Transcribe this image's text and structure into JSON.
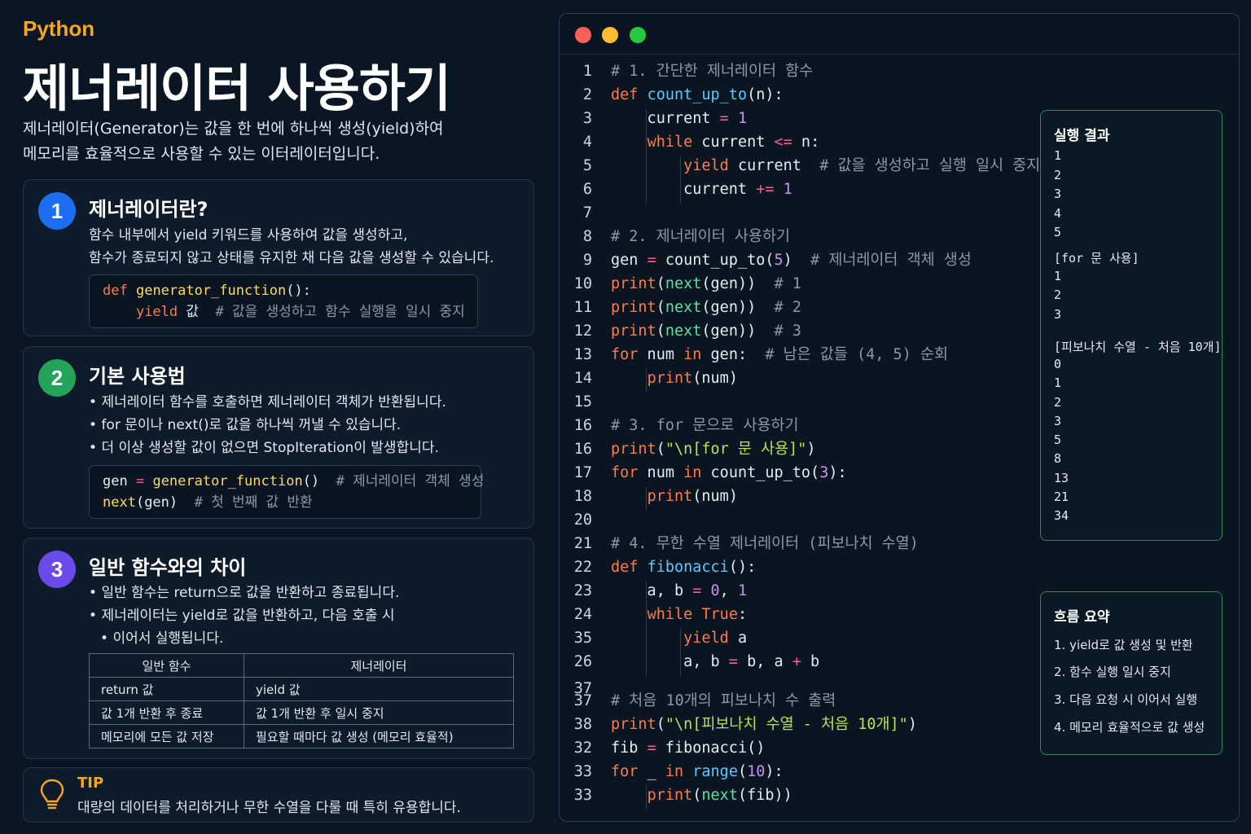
{
  "header": {
    "lang": "Python",
    "title": "제너레이터 사용하기",
    "intro_1": "제너레이터(Generator)는 값을 한 번에 하나씩 생성(yield)하여",
    "intro_2": "메모리를 효율적으로 사용할 수 있는 이터레이터입니다."
  },
  "cards": [
    {
      "num": "1",
      "title": "제너레이터란?",
      "text_1": "함수 내부에서 yield 키워드를 사용하여 값을 생성하고,",
      "text_2": "함수가 종료되지 않고 상태를 유지한 채 다음 값을 생성할 수 있습니다."
    },
    {
      "num": "2",
      "title": "기본 사용법",
      "bullets": [
        "제너레이터 함수를 호출하면 제너레이터 객체가 반환됩니다.",
        "for 문이나 next()로 값을 하나씩 꺼낼 수 있습니다.",
        "더 이상 생성할 값이 없으면 StopIteration이 발생합니다."
      ]
    },
    {
      "num": "3",
      "title": "일반 함수와의 차이",
      "bullets": [
        "일반 함수는 return으로 값을 반환하고 종료됩니다.",
        "제너레이터는 yield로 값을 반환하고, 다음 호출 시",
        "이어서 실행됩니다."
      ],
      "table": {
        "headers": [
          "일반 함수",
          "제너레이터"
        ],
        "rows": [
          [
            "return 값",
            "yield 값"
          ],
          [
            "값 1개 반환 후 종료",
            "값 1개 반환 후 일시 중지"
          ],
          [
            "메모리에 모든 값 저장",
            "필요할 때마다 값 생성 (메모리 효율적)"
          ]
        ]
      }
    }
  ],
  "tip": {
    "title": "TIP",
    "text": "대량의 데이터를 처리하거나 무한 수열을 다룰 때 특히 유용합니다."
  },
  "editor": {
    "window_dots": {
      "close": "#ff5f57",
      "minimize": "#febc2e",
      "maximize": "#28c840"
    },
    "line_numbers": [
      "1",
      "2",
      "3",
      "4",
      "5",
      "6",
      "7",
      "8",
      "9",
      "10",
      "11",
      "12",
      "13",
      "14",
      "15",
      "16",
      "16",
      "17",
      "18",
      "20",
      "21",
      "22",
      "23",
      "24",
      "35",
      "26",
      "37",
      "37",
      "38",
      "32",
      "33",
      "33"
    ]
  },
  "output_panel": {
    "title": "실행 결과",
    "lines": [
      "1",
      "2",
      "3",
      "4",
      "5",
      "",
      "[for 문 사용]",
      "1",
      "2",
      "3",
      "",
      "[피보나치 수열 - 처음 10개]",
      "0",
      "1",
      "2",
      "3",
      "5",
      "8",
      "13",
      "21",
      "34"
    ]
  },
  "summary_panel": {
    "title": "흐름 요약",
    "items": [
      "1. yield로 값 생성 및 반환",
      "2. 함수 실행 일시 중지",
      "3. 다음 요청 시 이어서 실행",
      "4. 메모리 효율적으로 값 생성"
    ]
  },
  "colors": {
    "background": "#0b1624",
    "accent_orange": "#f5a623",
    "badge_1": "#1e6ef2",
    "badge_2": "#24a35a",
    "badge_3": "#6a4bea",
    "panel_border": "#2e8b4a"
  }
}
